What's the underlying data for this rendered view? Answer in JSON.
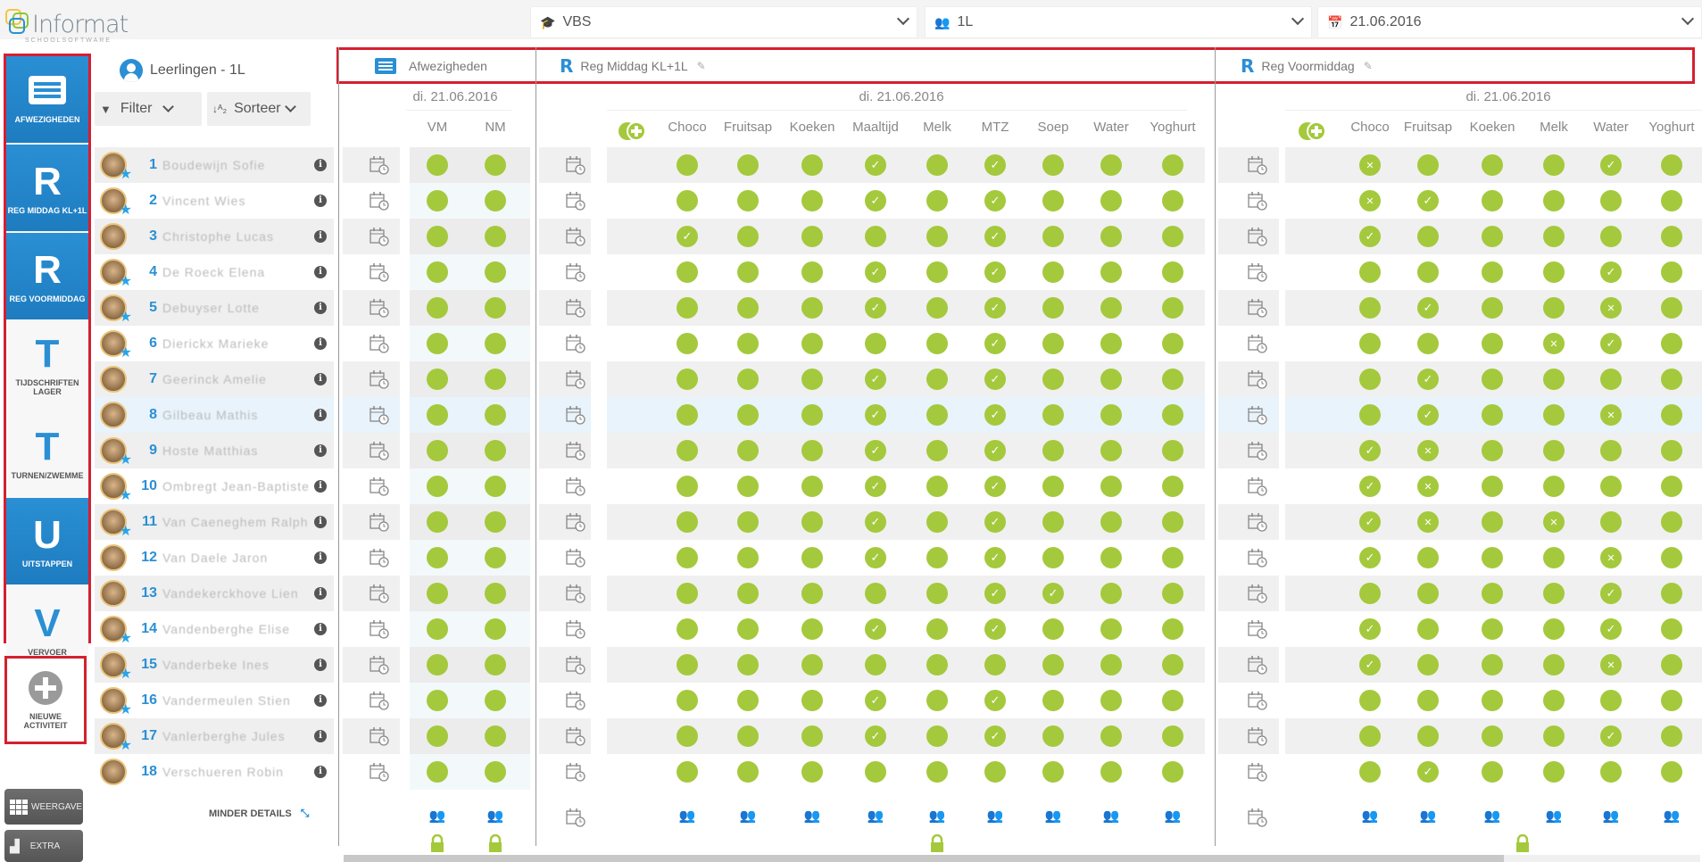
{
  "app": {
    "logo_text": "Informat",
    "logo_subtext": "SCHOOLSOFTWARE"
  },
  "topbar": {
    "school_select": {
      "icon": "graduation-cap-icon",
      "value": "VBS"
    },
    "class_select": {
      "icon": "users-icon",
      "value": "1L"
    },
    "date_select": {
      "icon": "calendar-icon",
      "value": "21.06.2016"
    }
  },
  "sidebar": {
    "items": [
      {
        "letter": "",
        "icon": "list-icon",
        "label": "AFWEZIGHEDEN",
        "active": true
      },
      {
        "letter": "R",
        "label": "REG MIDDAG KL+1L",
        "active": true
      },
      {
        "letter": "R",
        "label": "REG VOORMIDDAG",
        "active": true
      },
      {
        "letter": "T",
        "label": "TIJDSCHRIFTEN LAGER",
        "active": false
      },
      {
        "letter": "T",
        "label": "TURNEN/ZWEMME",
        "active": false
      },
      {
        "letter": "U",
        "label": "UITSTAPPEN",
        "active": true
      },
      {
        "letter": "V",
        "label": "VERVOER",
        "active": false
      }
    ],
    "new_activity_label": "NIEUWE ACTIVITEIT",
    "weergave_label": "WEERGAVE",
    "extra_label": "EXTRA"
  },
  "students_panel": {
    "title": "Leerlingen - 1L",
    "filter_label": "Filter",
    "sort_label": "Sorteer",
    "minder_details_label": "MINDER DETAILS",
    "students": [
      {
        "num": "1",
        "name": "Boudewijn Sofie",
        "star": true
      },
      {
        "num": "2",
        "name": "Vincent Wies",
        "star": true
      },
      {
        "num": "3",
        "name": "Christophe Lucas",
        "star": false
      },
      {
        "num": "4",
        "name": "De Roeck Elena",
        "star": true
      },
      {
        "num": "5",
        "name": "Debuyser Lotte",
        "star": true
      },
      {
        "num": "6",
        "name": "Dierickx Marieke",
        "star": true
      },
      {
        "num": "7",
        "name": "Geerinck Amelie",
        "star": false
      },
      {
        "num": "8",
        "name": "Gilbeau Mathis",
        "star": false
      },
      {
        "num": "9",
        "name": "Hoste Matthias",
        "star": true
      },
      {
        "num": "10",
        "name": "Ombregt Jean-Baptiste",
        "star": true
      },
      {
        "num": "11",
        "name": "Van Caeneghem Ralph",
        "star": true
      },
      {
        "num": "12",
        "name": "Van Daele Jaron",
        "star": false
      },
      {
        "num": "13",
        "name": "Vandekerckhove Lien",
        "star": false
      },
      {
        "num": "14",
        "name": "Vandenberghe Elise",
        "star": true
      },
      {
        "num": "15",
        "name": "Vanderbeke Ines",
        "star": true
      },
      {
        "num": "16",
        "name": "Vandermeulen Stien",
        "star": true
      },
      {
        "num": "17",
        "name": "Vanlerberghe Jules",
        "star": true
      },
      {
        "num": "18",
        "name": "Verschueren Robin",
        "star": false
      }
    ],
    "highlighted_row": 8
  },
  "activities": [
    {
      "id": "afwezigheden",
      "title": "Afwezigheden",
      "icon": "list-icon",
      "date": "di. 21.06.2016",
      "columns": [
        "VM",
        "NM"
      ]
    },
    {
      "id": "reg-middag",
      "title": "Reg Middag KL+1L",
      "icon": "R",
      "date": "di. 21.06.2016",
      "columns": [
        "Choco",
        "Fruitsap",
        "Koeken",
        "Maaltijd",
        "Melk",
        "MTZ",
        "Soep",
        "Water",
        "Yoghurt"
      ]
    },
    {
      "id": "reg-voormiddag",
      "title": "Reg Voormiddag",
      "icon": "R",
      "date": "di. 21.06.2016",
      "columns": [
        "Choco",
        "Fruitsap",
        "Koeken",
        "Melk",
        "Water",
        "Yoghurt"
      ]
    }
  ],
  "grid_legend": {
    "empty": "dot",
    "check": "registered",
    "cross": "cancelled"
  },
  "grid": {
    "afwezigheden": [
      [
        "dot",
        "dot"
      ],
      [
        "dot",
        "dot"
      ],
      [
        "dot",
        "dot"
      ],
      [
        "dot",
        "dot"
      ],
      [
        "dot",
        "dot"
      ],
      [
        "dot",
        "dot"
      ],
      [
        "dot",
        "dot"
      ],
      [
        "dot",
        "dot"
      ],
      [
        "dot",
        "dot"
      ],
      [
        "dot",
        "dot"
      ],
      [
        "dot",
        "dot"
      ],
      [
        "dot",
        "dot"
      ],
      [
        "dot",
        "dot"
      ],
      [
        "dot",
        "dot"
      ],
      [
        "dot",
        "dot"
      ],
      [
        "dot",
        "dot"
      ],
      [
        "dot",
        "dot"
      ],
      [
        "dot",
        "dot"
      ]
    ],
    "reg_middag": [
      [
        "dot",
        "dot",
        "dot",
        "check",
        "dot",
        "check",
        "dot",
        "dot",
        "dot"
      ],
      [
        "dot",
        "dot",
        "dot",
        "check",
        "dot",
        "check",
        "dot",
        "dot",
        "dot"
      ],
      [
        "check",
        "dot",
        "dot",
        "dot",
        "dot",
        "check",
        "dot",
        "dot",
        "dot"
      ],
      [
        "dot",
        "dot",
        "dot",
        "check",
        "dot",
        "check",
        "dot",
        "dot",
        "dot"
      ],
      [
        "dot",
        "dot",
        "dot",
        "check",
        "dot",
        "check",
        "dot",
        "dot",
        "dot"
      ],
      [
        "dot",
        "dot",
        "dot",
        "dot",
        "dot",
        "check",
        "dot",
        "dot",
        "dot"
      ],
      [
        "dot",
        "dot",
        "dot",
        "check",
        "dot",
        "check",
        "dot",
        "dot",
        "dot"
      ],
      [
        "dot",
        "dot",
        "dot",
        "check",
        "dot",
        "check",
        "dot",
        "dot",
        "dot"
      ],
      [
        "dot",
        "dot",
        "dot",
        "check",
        "dot",
        "check",
        "dot",
        "dot",
        "dot"
      ],
      [
        "dot",
        "dot",
        "dot",
        "check",
        "dot",
        "check",
        "dot",
        "dot",
        "dot"
      ],
      [
        "dot",
        "dot",
        "dot",
        "check",
        "dot",
        "check",
        "dot",
        "dot",
        "dot"
      ],
      [
        "dot",
        "dot",
        "dot",
        "check",
        "dot",
        "check",
        "dot",
        "dot",
        "dot"
      ],
      [
        "dot",
        "dot",
        "dot",
        "dot",
        "dot",
        "check",
        "check",
        "dot",
        "dot"
      ],
      [
        "dot",
        "dot",
        "dot",
        "check",
        "dot",
        "check",
        "dot",
        "dot",
        "dot"
      ],
      [
        "dot",
        "dot",
        "dot",
        "dot",
        "dot",
        "dot",
        "dot",
        "dot",
        "dot"
      ],
      [
        "dot",
        "dot",
        "dot",
        "check",
        "dot",
        "check",
        "dot",
        "dot",
        "dot"
      ],
      [
        "dot",
        "dot",
        "dot",
        "check",
        "dot",
        "check",
        "dot",
        "dot",
        "dot"
      ],
      [
        "dot",
        "dot",
        "dot",
        "dot",
        "dot",
        "dot",
        "dot",
        "dot",
        "dot"
      ]
    ],
    "reg_voormiddag": [
      [
        "cross",
        "dot",
        "dot",
        "dot",
        "check",
        "dot"
      ],
      [
        "cross",
        "check",
        "dot",
        "dot",
        "dot",
        "dot"
      ],
      [
        "check",
        "dot",
        "dot",
        "dot",
        "dot",
        "dot"
      ],
      [
        "dot",
        "dot",
        "dot",
        "dot",
        "check",
        "dot"
      ],
      [
        "dot",
        "check",
        "dot",
        "dot",
        "cross",
        "dot"
      ],
      [
        "dot",
        "dot",
        "dot",
        "cross",
        "check",
        "dot"
      ],
      [
        "dot",
        "check",
        "dot",
        "dot",
        "dot",
        "dot"
      ],
      [
        "dot",
        "check",
        "dot",
        "dot",
        "cross",
        "dot"
      ],
      [
        "check",
        "cross",
        "dot",
        "dot",
        "dot",
        "dot"
      ],
      [
        "check",
        "cross",
        "dot",
        "dot",
        "dot",
        "dot"
      ],
      [
        "check",
        "cross",
        "dot",
        "cross",
        "dot",
        "dot"
      ],
      [
        "check",
        "dot",
        "dot",
        "dot",
        "cross",
        "dot"
      ],
      [
        "dot",
        "dot",
        "dot",
        "dot",
        "check",
        "dot"
      ],
      [
        "check",
        "dot",
        "dot",
        "dot",
        "check",
        "dot"
      ],
      [
        "check",
        "dot",
        "dot",
        "dot",
        "cross",
        "dot"
      ],
      [
        "dot",
        "dot",
        "dot",
        "dot",
        "dot",
        "dot"
      ],
      [
        "dot",
        "dot",
        "dot",
        "dot",
        "check",
        "dot"
      ],
      [
        "dot",
        "check",
        "dot",
        "dot",
        "dot",
        "dot"
      ]
    ]
  },
  "colors": {
    "accent_blue": "#2a8fd4",
    "status_green": "#a4c93c",
    "highlight_red": "#d42030",
    "star_blue": "#29a3e8"
  }
}
